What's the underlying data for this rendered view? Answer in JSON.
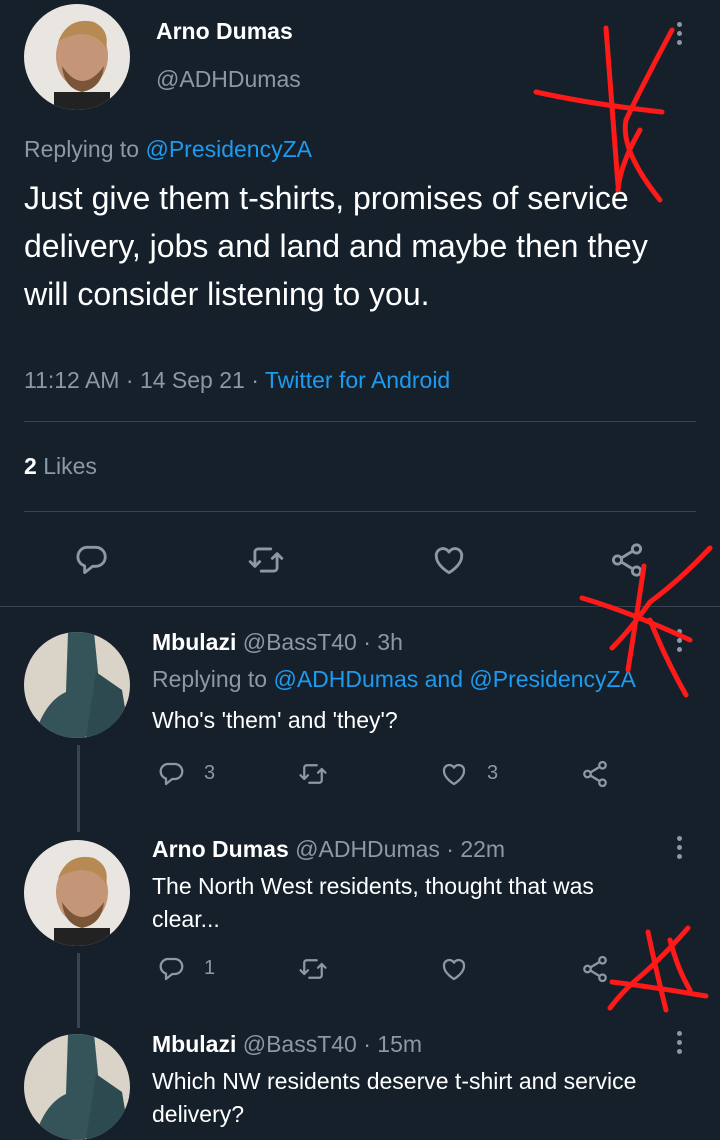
{
  "main_tweet": {
    "author_name": "Arno Dumas",
    "author_handle": "@ADHDumas",
    "replying_prefix": "Replying to",
    "replying_to": "@PresidencyZA",
    "text": "Just give them t-shirts, promises of service delivery, jobs and land and maybe then they will consider listening to you.",
    "time": "11:12 AM",
    "date": "14 Sep 21",
    "sep1": "·",
    "sep2": "·",
    "source": "Twitter for Android",
    "likes_count": "2",
    "likes_label": "Likes",
    "actions": [
      "reply-icon",
      "retweet-icon",
      "like-icon",
      "share-icon"
    ]
  },
  "replies": [
    {
      "author_name": "Mbulazi",
      "author_handle": "@BassT40",
      "time_ago": "· 3h",
      "replying_prefix": "Replying to",
      "replying_to": "@ADHDumas and @PresidencyZA",
      "text": "Who's 'them' and 'they'?",
      "reply_count": "3",
      "retweet_count": "",
      "like_count": "3"
    },
    {
      "author_name": "Arno Dumas",
      "author_handle": "@ADHDumas",
      "time_ago": "· 22m",
      "text_line1": "The North West residents, thought that was",
      "text_line2": "clear...",
      "reply_count": "1",
      "retweet_count": "",
      "like_count": ""
    },
    {
      "author_name": "Mbulazi",
      "author_handle": "@BassT40",
      "time_ago": "· 15m",
      "text_line1": "Which NW residents deserve t-shirt and service",
      "text_line2": "delivery?"
    }
  ],
  "colors": {
    "background": "#15202b",
    "muted": "#8b98a5",
    "link": "#1d9bf0",
    "annotation": "#ff1a1a"
  }
}
